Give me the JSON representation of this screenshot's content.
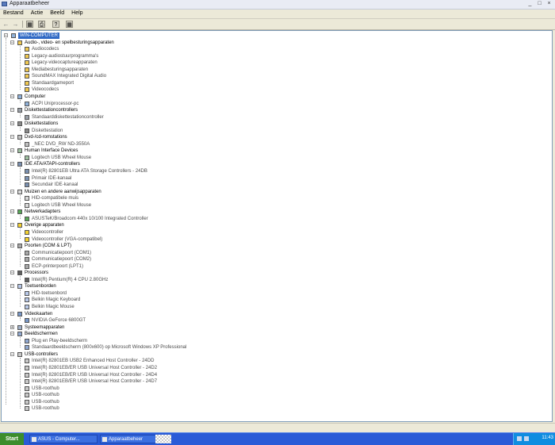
{
  "window": {
    "title": "Apparaatbeheer",
    "buttons": [
      "_",
      "□",
      "×"
    ]
  },
  "menu": [
    "Bestand",
    "Actie",
    "Beeld",
    "Help"
  ],
  "toolbar": {
    "back_icon": "back-arrow-icon",
    "forward_icon": "forward-arrow-icon",
    "properties_icon": "properties-icon",
    "print_icon": "print-icon",
    "help_icon": "help-icon",
    "scan_icon": "scan-hardware-icon"
  },
  "tree": {
    "root": "WIN-COMPUTER",
    "categories": [
      {
        "label": "Audio-, video- en spelbesturingsapparaten",
        "icon": "sound-icon",
        "expanded": true,
        "children": [
          "Audiocodecs",
          "Legacy-audiostuurprogramma's",
          "Legacy-videocaptureapparaten",
          "Mediabesturingsapparaten",
          "SoundMAX Integrated Digital Audio",
          "Standaardgameport",
          "Videocodecs"
        ]
      },
      {
        "label": "Computer",
        "icon": "computer-icon",
        "expanded": true,
        "children": [
          "ACPI Uniprocessor-pc"
        ]
      },
      {
        "label": "Diskettestationcontrollers",
        "icon": "floppy-controller-icon",
        "expanded": true,
        "children": [
          "Standaarddiskettestationcontroller"
        ]
      },
      {
        "label": "Diskettestations",
        "icon": "floppy-drive-icon",
        "expanded": true,
        "children": [
          "Diskettestation"
        ]
      },
      {
        "label": "Dvd-/cd-romstations",
        "icon": "cdrom-icon",
        "expanded": true,
        "children": [
          "_NEC DVD_RW ND-3550A"
        ]
      },
      {
        "label": "Human Interface Devices",
        "icon": "hid-icon",
        "expanded": true,
        "children": [
          "Logitech USB Wheel Mouse"
        ]
      },
      {
        "label": "IDE ATA/ATAPI-controllers",
        "icon": "ide-icon",
        "expanded": true,
        "children": [
          "Intel(R) 82801EB Ultra ATA Storage Controllers - 24DB",
          "Primair IDE-kanaal",
          "Secundair IDE-kanaal"
        ]
      },
      {
        "label": "Muizen en andere aanwijsapparaten",
        "icon": "mouse-icon",
        "expanded": true,
        "children": [
          "HID-compatibele muis",
          "Logitech USB Wheel Mouse"
        ]
      },
      {
        "label": "Netwerkadapters",
        "icon": "network-icon",
        "expanded": true,
        "children": [
          "ASUSTeK/Broadcom 440x 10/100 Integrated Controller"
        ]
      },
      {
        "label": "Overige apparaten",
        "icon": "unknown-device-icon",
        "expanded": true,
        "children": [
          "Videocontroller",
          "Videocontroller (VGA-compatibel)"
        ]
      },
      {
        "label": "Poorten (COM & LPT)",
        "icon": "port-icon",
        "expanded": true,
        "children": [
          "Communicatiepoort (COM1)",
          "Communicatiepoort (COM2)",
          "ECP-printerpoort (LPT1)"
        ]
      },
      {
        "label": "Processors",
        "icon": "processor-icon",
        "expanded": true,
        "children": [
          "Intel(R) Pentium(R) 4 CPU 2.80GHz"
        ]
      },
      {
        "label": "Toetsenborden",
        "icon": "keyboard-icon",
        "expanded": true,
        "children": [
          "HID-toetsenbord",
          "Belkin Magic Keyboard",
          "Belkin Magic Mouse"
        ]
      },
      {
        "label": "Videokaarten",
        "icon": "display-icon",
        "expanded": true,
        "children": [
          "NVIDIA GeForce 6800GT"
        ]
      },
      {
        "label": "Systeemapparaten",
        "icon": "system-icon",
        "expanded": false,
        "children": []
      },
      {
        "label": "Beeldschermen",
        "icon": "monitor-icon",
        "expanded": true,
        "children": [
          "Plug en Play-beeldscherm",
          "Standaardbeeldscherm (800x600) op Microsoft Windows XP Professional"
        ]
      },
      {
        "label": "USB-controllers",
        "icon": "usb-icon",
        "expanded": true,
        "children": [
          "Intel(R) 82801EB USB2 Enhanced Host Controller - 24DD",
          "Intel(R) 82801EB/ER USB Universal Host Controller - 24D2",
          "Intel(R) 82801EB/ER USB Universal Host Controller - 24D4",
          "Intel(R) 82801EB/ER USB Universal Host Controller - 24D7",
          "USB-roothub",
          "USB-roothub",
          "USB-roothub",
          "USB-roothub"
        ]
      }
    ]
  },
  "taskbar": {
    "start_label": "Start",
    "tasks": [
      "ASUS - Computer...",
      "",
      "Apparaatbeheer"
    ],
    "clock": "11:43"
  },
  "colors": {
    "selection": "#316ac5",
    "taskbar": "#2a5bd7",
    "start": "#3c8d2c"
  }
}
